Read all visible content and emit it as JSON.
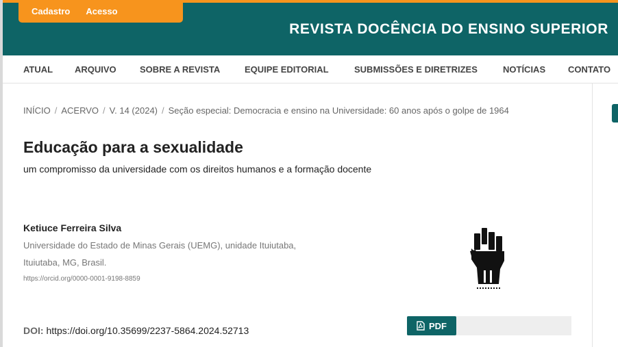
{
  "user_nav": {
    "register": "Cadastro",
    "login": "Acesso"
  },
  "site": {
    "title": "REVISTA DOCÊNCIA DO ENSINO SUPERIOR"
  },
  "nav": {
    "items": [
      "ATUAL",
      "ARQUIVO",
      "SOBRE A REVISTA",
      "EQUIPE EDITORIAL",
      "SUBMISSÕES E DIRETRIZES",
      "NOTÍCIAS",
      "CONTATO"
    ]
  },
  "breadcrumb": {
    "home": "INÍCIO",
    "archive": "ACERVO",
    "issue": "V. 14 (2024)",
    "section": "Seção especial: Democracia e ensino na Universidade: 60 anos após o golpe de 1964"
  },
  "article": {
    "title": "Educação para a sexualidade",
    "subtitle": "um compromisso da universidade com os direitos humanos e a formação docente",
    "author": {
      "name": "Ketiuce Ferreira Silva",
      "affiliation_line1": "Universidade do Estado de Minas Gerais (UEMG), unidade Ituiutaba,",
      "affiliation_line2": "Ituiutaba, MG, Brasil.",
      "orcid": "https://orcid.org/0000-0001-9198-8859"
    },
    "doi_label": "DOI:",
    "doi_url": "https://doi.org/10.35699/2237-5864.2024.52713",
    "pdf_label": "PDF"
  },
  "colors": {
    "primary": "#0e6466",
    "accent": "#f7941d"
  },
  "icons": {
    "pdf": "file-pdf-icon",
    "cover": "raised-fist-icon"
  }
}
